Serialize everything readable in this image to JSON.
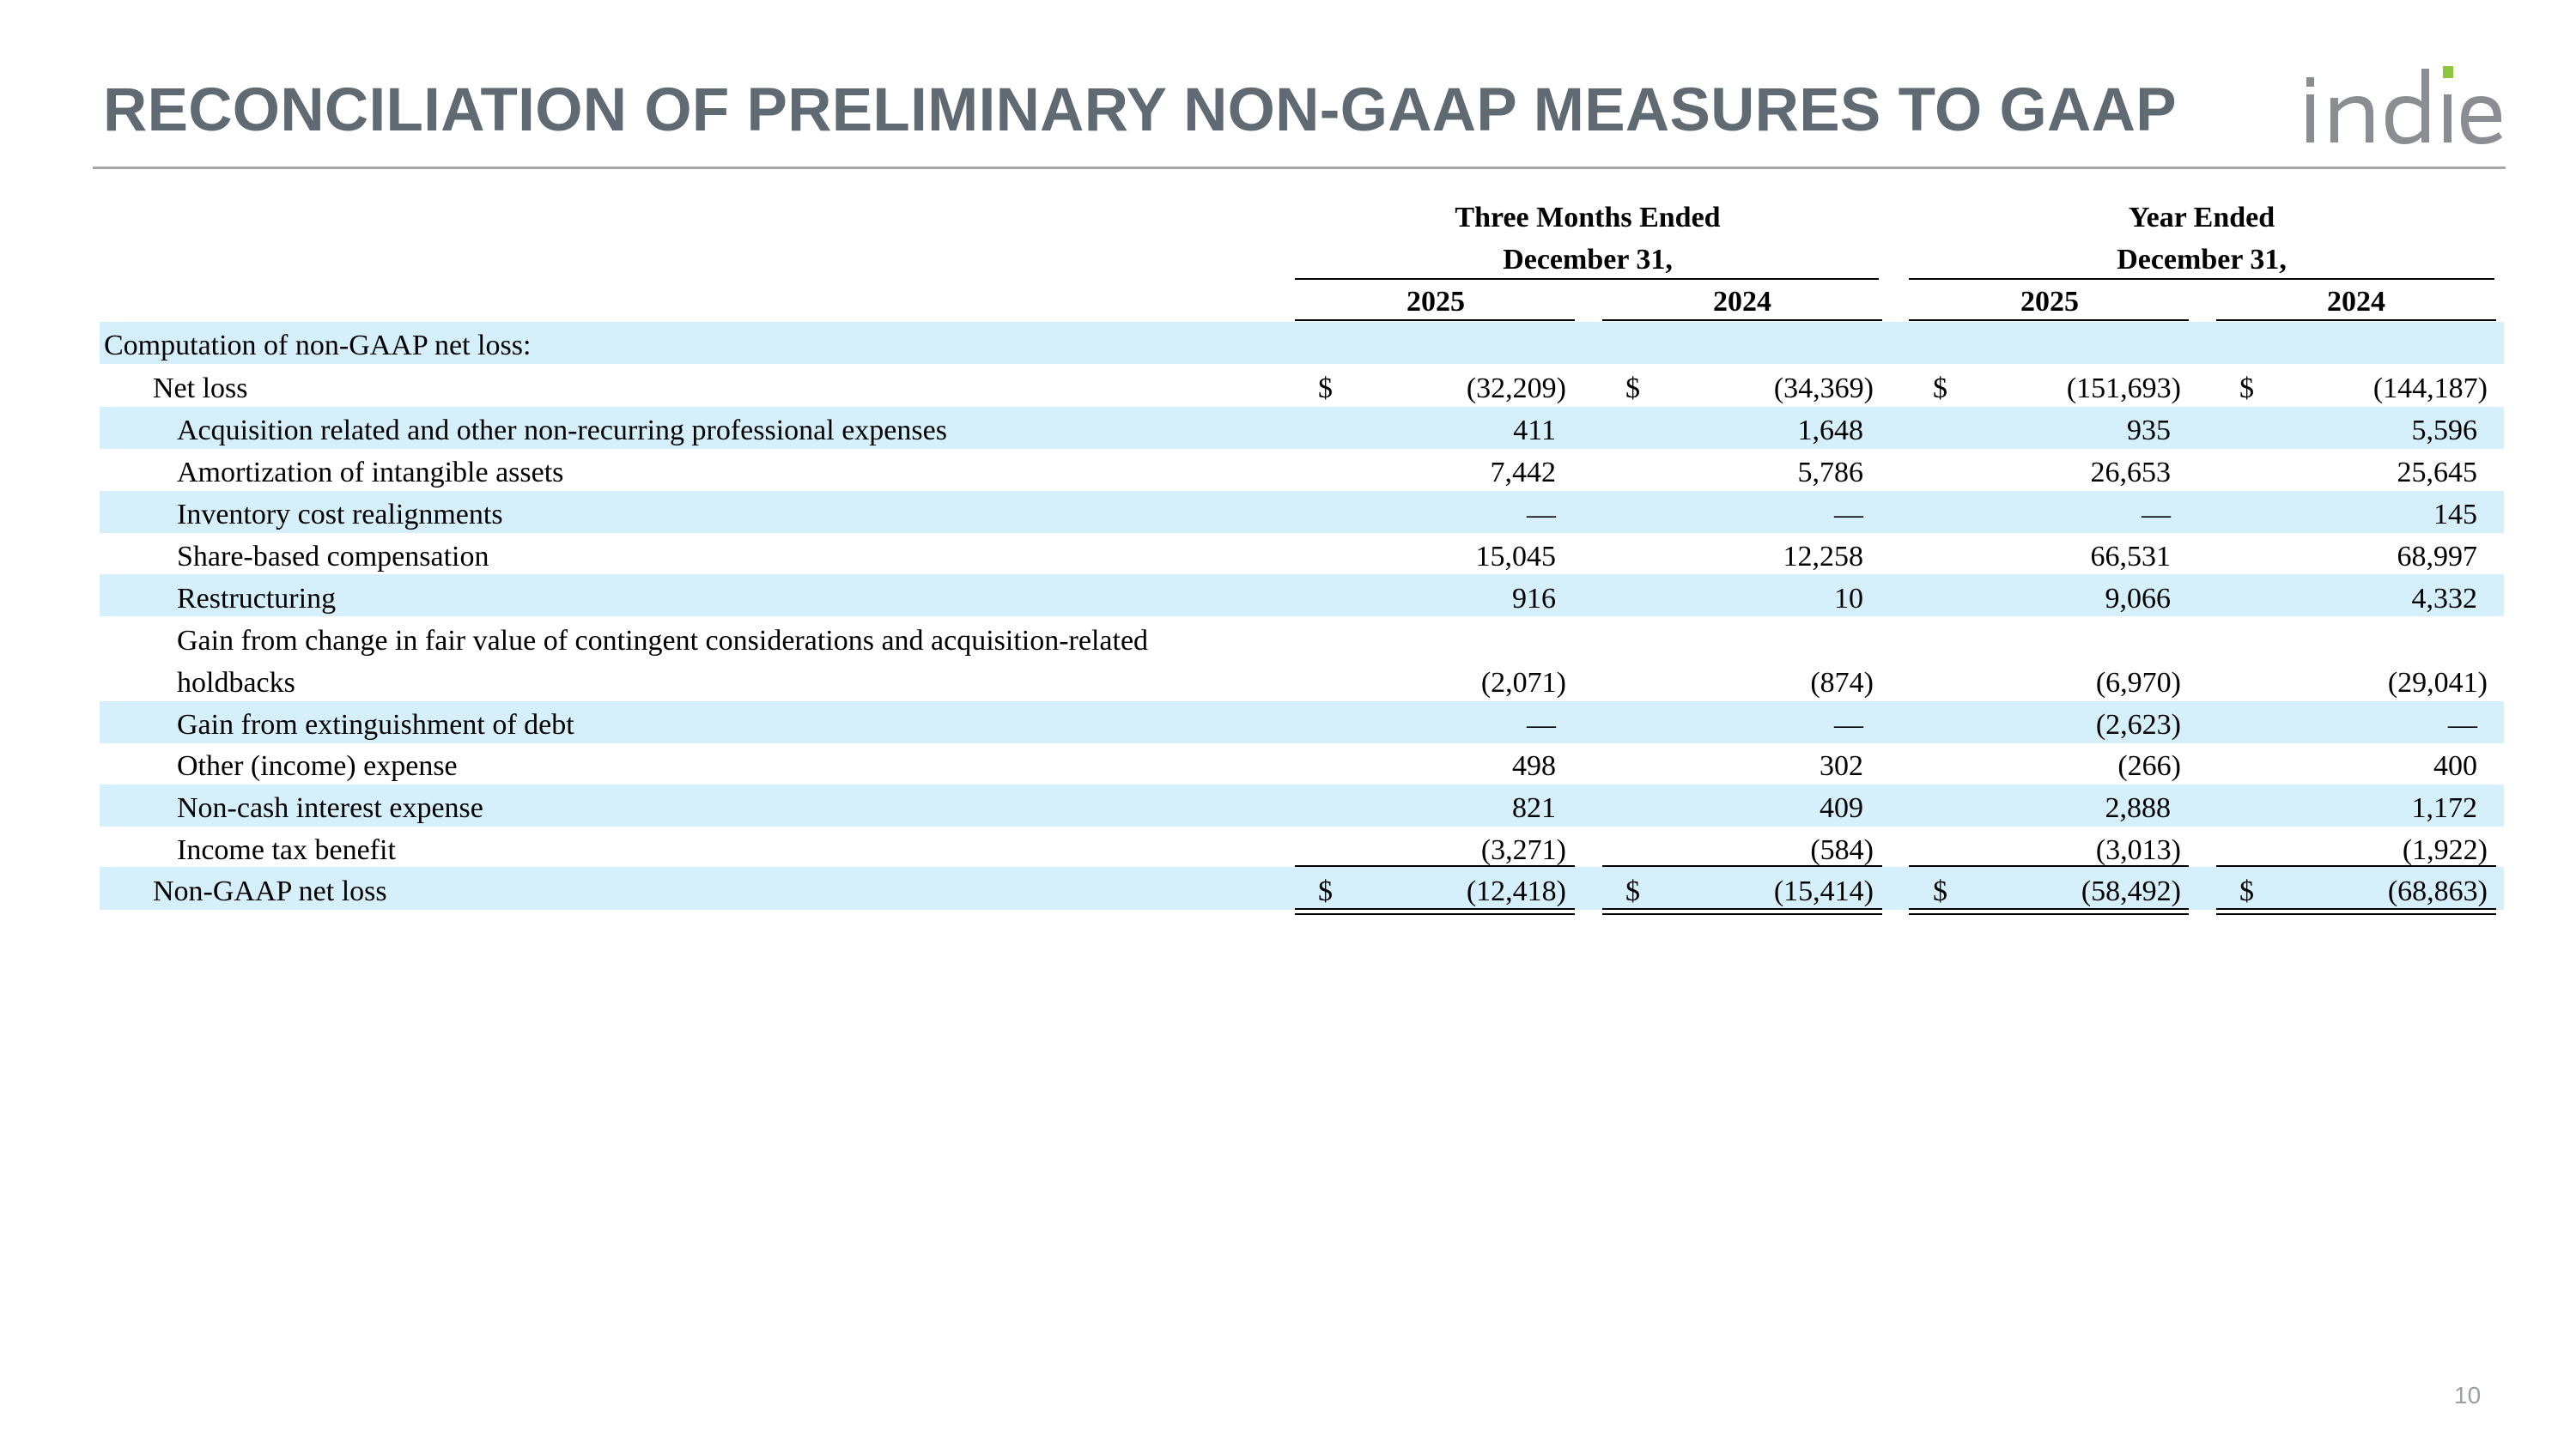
{
  "title": "RECONCILIATION OF PRELIMINARY NON-GAAP MEASURES TO GAAP",
  "logo": {
    "text": "indie",
    "accent_color": "#8dc63f",
    "text_color": "#8a8d91"
  },
  "page_number": "10",
  "colors": {
    "stripe": "#d6f0fb",
    "title": "#5f6a73"
  },
  "table": {
    "group_headers": [
      {
        "line1": "Three Months Ended",
        "line2": "December 31,"
      },
      {
        "line1": "Year Ended",
        "line2": "December 31,"
      }
    ],
    "years": [
      "2025",
      "2024",
      "2025",
      "2024"
    ],
    "section_label": "Computation of non-GAAP net loss:",
    "net_loss": {
      "label": "Net loss",
      "currency": "$",
      "values": [
        "(32,209)",
        "(34,369)",
        "(151,693)",
        "(144,187)"
      ]
    },
    "adjustments": [
      {
        "label": "Acquisition related and other non-recurring professional expenses",
        "values": [
          "411",
          "1,648",
          "935",
          "5,596"
        ]
      },
      {
        "label": "Amortization of intangible assets",
        "values": [
          "7,442",
          "5,786",
          "26,653",
          "25,645"
        ]
      },
      {
        "label": "Inventory cost realignments",
        "values": [
          "—",
          "—",
          "—",
          "145"
        ]
      },
      {
        "label": "Share-based compensation",
        "values": [
          "15,045",
          "12,258",
          "66,531",
          "68,997"
        ]
      },
      {
        "label": "Restructuring",
        "values": [
          "916",
          "10",
          "9,066",
          "4,332"
        ]
      },
      {
        "label": "Gain from change in fair value of contingent considerations and acquisition-related",
        "label2": "holdbacks",
        "values": [
          "(2,071)",
          "(874)",
          "(6,970)",
          "(29,041)"
        ]
      },
      {
        "label": "Gain from extinguishment of debt",
        "values": [
          "—",
          "—",
          "(2,623)",
          "—"
        ]
      },
      {
        "label": "Other (income) expense",
        "values": [
          "498",
          "302",
          "(266)",
          "400"
        ]
      },
      {
        "label": "Non-cash interest expense",
        "values": [
          "821",
          "409",
          "2,888",
          "1,172"
        ]
      },
      {
        "label": "Income tax benefit",
        "values": [
          "(3,271)",
          "(584)",
          "(3,013)",
          "(1,922)"
        ]
      }
    ],
    "total": {
      "label": "Non-GAAP net loss",
      "currency": "$",
      "values": [
        "(12,418)",
        "(15,414)",
        "(58,492)",
        "(68,863)"
      ]
    }
  }
}
